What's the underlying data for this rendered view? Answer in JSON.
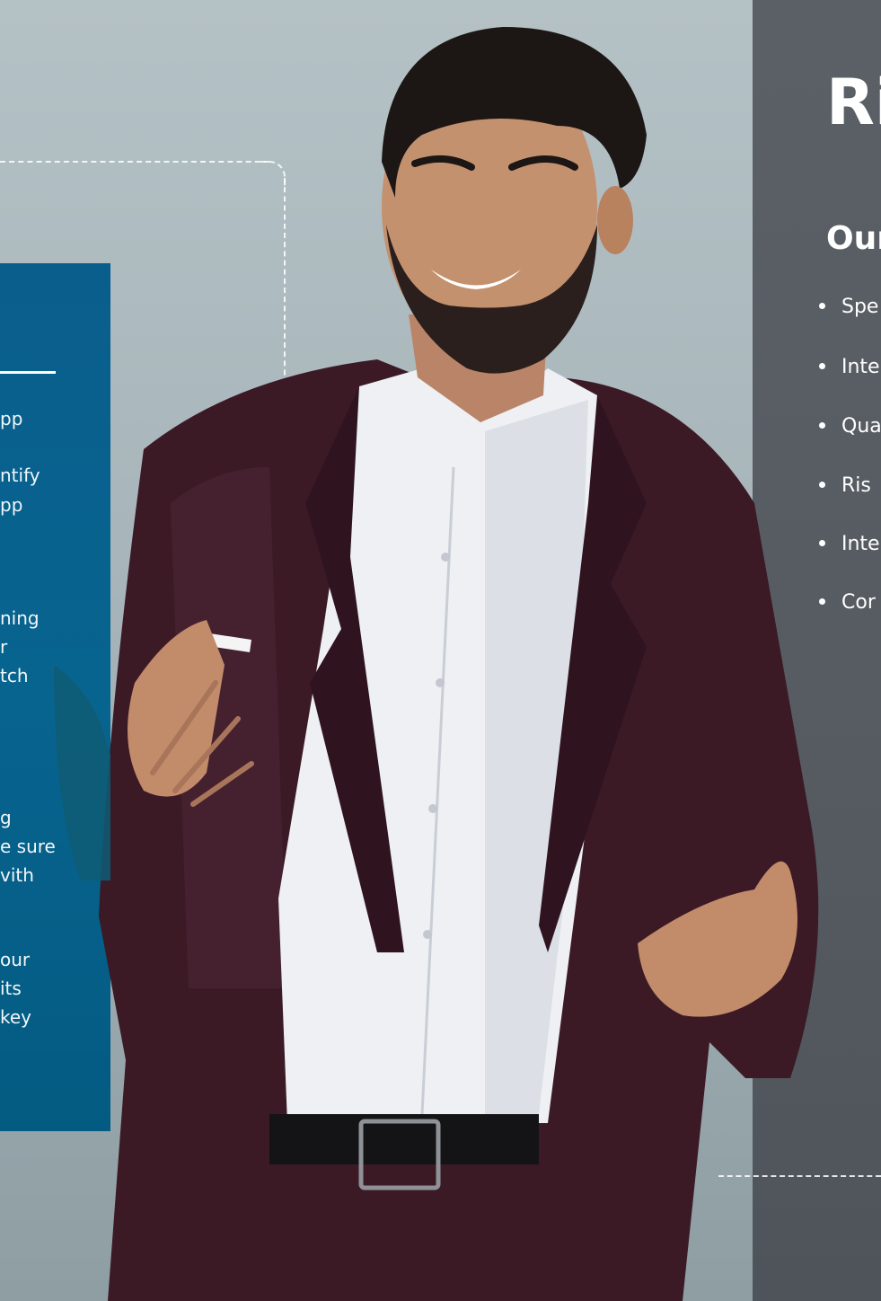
{
  "left_panel": {
    "fragments": [
      "pp",
      "ntify",
      "pp",
      "ning",
      "r",
      "tch",
      "g",
      "e sure",
      "vith",
      "our",
      "its",
      "key"
    ]
  },
  "right_panel": {
    "title": "Ri",
    "subtitle": "Our",
    "bullets": [
      "Spe",
      "Inte",
      "Qua",
      "Ris",
      "Inte",
      "Cor"
    ]
  },
  "colors": {
    "background": "#b4c1c5",
    "blue_panel": "#07648f",
    "dark_panel": "#575d63",
    "jacket": "#3b1a26",
    "shirt": "#eef0f3",
    "text": "#ffffff"
  },
  "image": {
    "subject": "smiling-man-in-burgundy-suit-icon"
  }
}
